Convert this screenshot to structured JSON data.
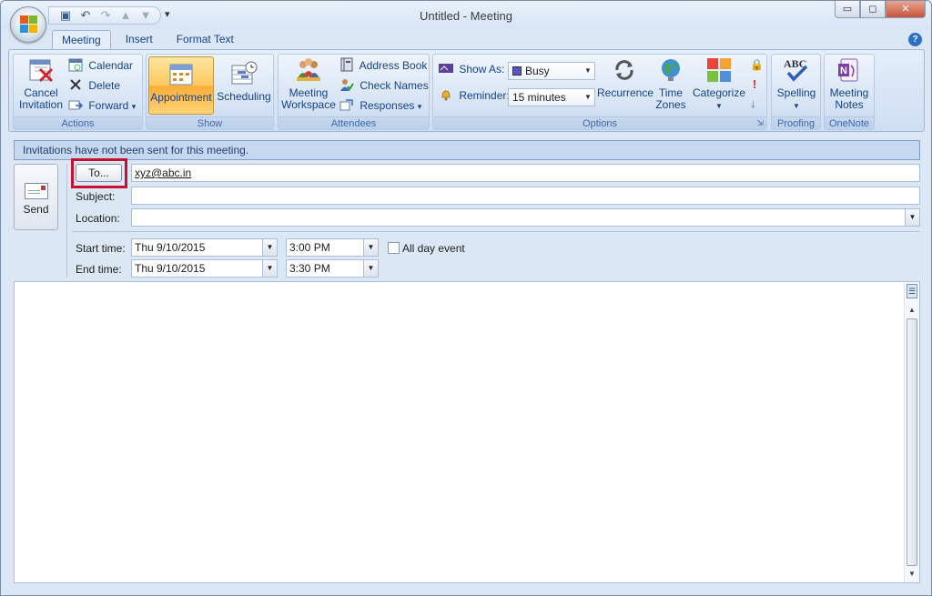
{
  "window": {
    "title": "Untitled - Meeting",
    "buttons": {
      "minimize": "▭",
      "maximize": "◻",
      "close": "✕"
    }
  },
  "qat_icons": [
    "save-icon",
    "undo-icon",
    "redo-icon",
    "prev-item-icon",
    "next-item-icon"
  ],
  "tabs": [
    {
      "label": "Meeting",
      "active": true
    },
    {
      "label": "Insert",
      "active": false
    },
    {
      "label": "Format Text",
      "active": false
    }
  ],
  "help_label": "?",
  "ribbon": {
    "actions": {
      "label": "Actions",
      "cancel_line1": "Cancel",
      "cancel_line2": "Invitation",
      "calendar": "Calendar",
      "delete": "Delete",
      "forward": "Forward"
    },
    "show": {
      "label": "Show",
      "appointment": "Appointment",
      "scheduling": "Scheduling"
    },
    "attendees": {
      "label": "Attendees",
      "workspace_line1": "Meeting",
      "workspace_line2": "Workspace",
      "address_book": "Address Book",
      "check_names": "Check Names",
      "responses": "Responses"
    },
    "options": {
      "label": "Options",
      "show_as_label": "Show As:",
      "show_as_value": "Busy",
      "reminder_label": "Reminder:",
      "reminder_value": "15 minutes",
      "recurrence": "Recurrence",
      "time_zones_line1": "Time",
      "time_zones_line2": "Zones",
      "categorize": "Categorize"
    },
    "proofing": {
      "label": "Proofing",
      "spelling": "Spelling"
    },
    "onenote": {
      "label": "OneNote",
      "notes_line1": "Meeting",
      "notes_line2": "Notes"
    }
  },
  "infobar": "Invitations have not been sent for this meeting.",
  "form": {
    "send": "Send",
    "to_button": "To...",
    "to_value": "xyz@abc.in",
    "subject_label": "Subject:",
    "subject_value": "",
    "location_label": "Location:",
    "location_value": "",
    "start_label": "Start time:",
    "start_date": "Thu 9/10/2015",
    "start_time": "3:00 PM",
    "end_label": "End time:",
    "end_date": "Thu 9/10/2015",
    "end_time": "3:30 PM",
    "all_day": "All day event"
  },
  "colors": {
    "highlight_box": "#c8102e",
    "busy_swatch": "#5b57c9",
    "selected_button": "#fbc95c"
  }
}
